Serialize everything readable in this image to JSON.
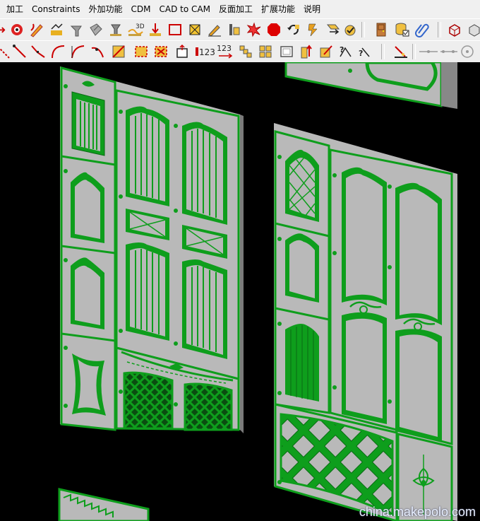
{
  "menu": [
    "加工",
    "Constraints",
    "外加功能",
    "CDM",
    "CAD to CAM",
    "反面加工",
    "扩展功能",
    "说明"
  ],
  "toolbar2_text": {
    "n123": "123",
    "n123b": "123"
  },
  "watermark": "china.makepolo.com",
  "colors": {
    "model_green": "#0e9e1c",
    "panel_grey": "#b9b9b9",
    "toolbar_bg": "#eeeeee",
    "menubar_bg": "#f0f0f0",
    "canvas_bg": "#000000"
  }
}
